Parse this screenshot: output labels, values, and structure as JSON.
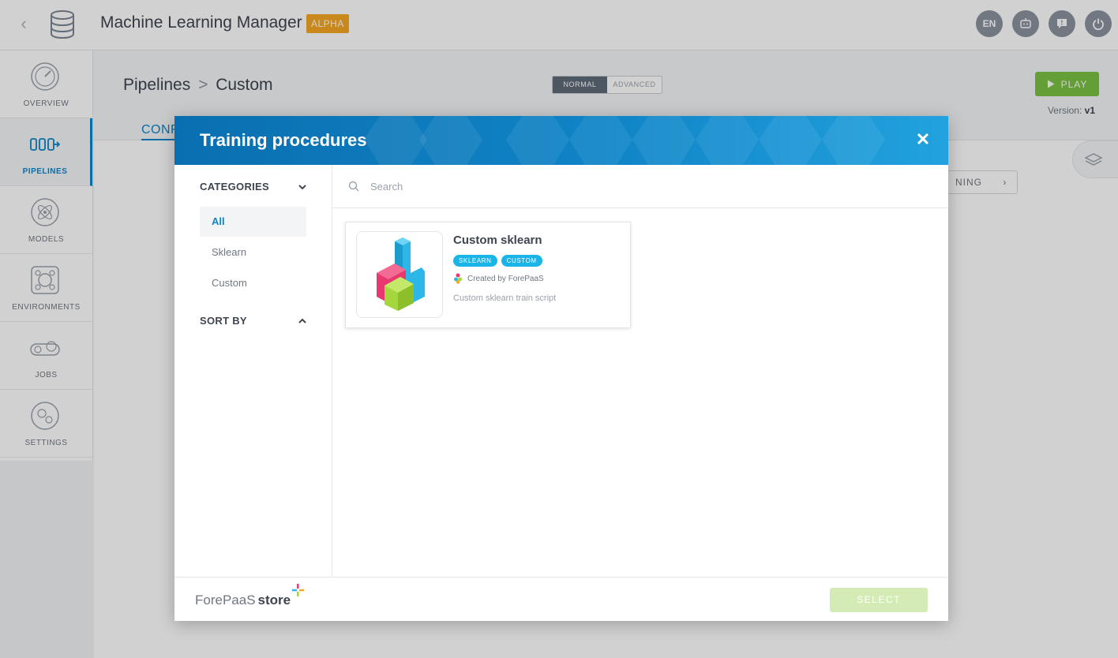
{
  "header": {
    "back_icon": "chevron-left-icon",
    "app_icon": "database-icon",
    "title": "Machine Learning Manager",
    "badge": "ALPHA",
    "icons": [
      {
        "name": "language",
        "label": "EN"
      },
      {
        "name": "robot-icon",
        "label": ""
      },
      {
        "name": "help-icon",
        "label": ""
      },
      {
        "name": "power-icon",
        "label": ""
      }
    ]
  },
  "sidebar": {
    "items": [
      {
        "label": "OVERVIEW",
        "icon": "gauge-icon",
        "active": false
      },
      {
        "label": "PIPELINES",
        "icon": "pipeline-icon",
        "active": true
      },
      {
        "label": "MODELS",
        "icon": "atom-icon",
        "active": false
      },
      {
        "label": "ENVIRONMENTS",
        "icon": "environment-icon",
        "active": false
      },
      {
        "label": "JOBS",
        "icon": "gears-icon",
        "active": false
      },
      {
        "label": "SETTINGS",
        "icon": "settings-icon",
        "active": false
      }
    ]
  },
  "page": {
    "breadcrumb": {
      "parent": "Pipelines",
      "separator": ">",
      "current": "Custom"
    },
    "mode": {
      "normal": "NORMAL",
      "advanced": "ADVANCED",
      "selected": "NORMAL"
    },
    "play_label": "PLAY",
    "version_label": "Version:",
    "version_value": "v1",
    "tab_label": "CONF",
    "step_label": "NING"
  },
  "modal": {
    "title": "Training procedures",
    "close_icon": "close-icon",
    "categories_title": "CATEGORIES",
    "categories": [
      {
        "label": "All",
        "active": true
      },
      {
        "label": "Sklearn",
        "active": false
      },
      {
        "label": "Custom",
        "active": false
      }
    ],
    "sort_title": "SORT BY",
    "search": {
      "placeholder": "Search",
      "value": ""
    },
    "cards": [
      {
        "title": "Custom sklearn",
        "tags": [
          "SKLEARN",
          "CUSTOM"
        ],
        "author": "Created by ForePaaS",
        "description": "Custom sklearn train script"
      }
    ],
    "footer": {
      "store_brand": "ForePaaS",
      "store_label": "store",
      "select_label": "SELECT"
    }
  },
  "colors": {
    "accent": "#0a86c8",
    "play": "#7ac142",
    "alpha": "#f5a623",
    "tag": "#1ab5e8",
    "select_disabled": "#d4ebb5"
  }
}
